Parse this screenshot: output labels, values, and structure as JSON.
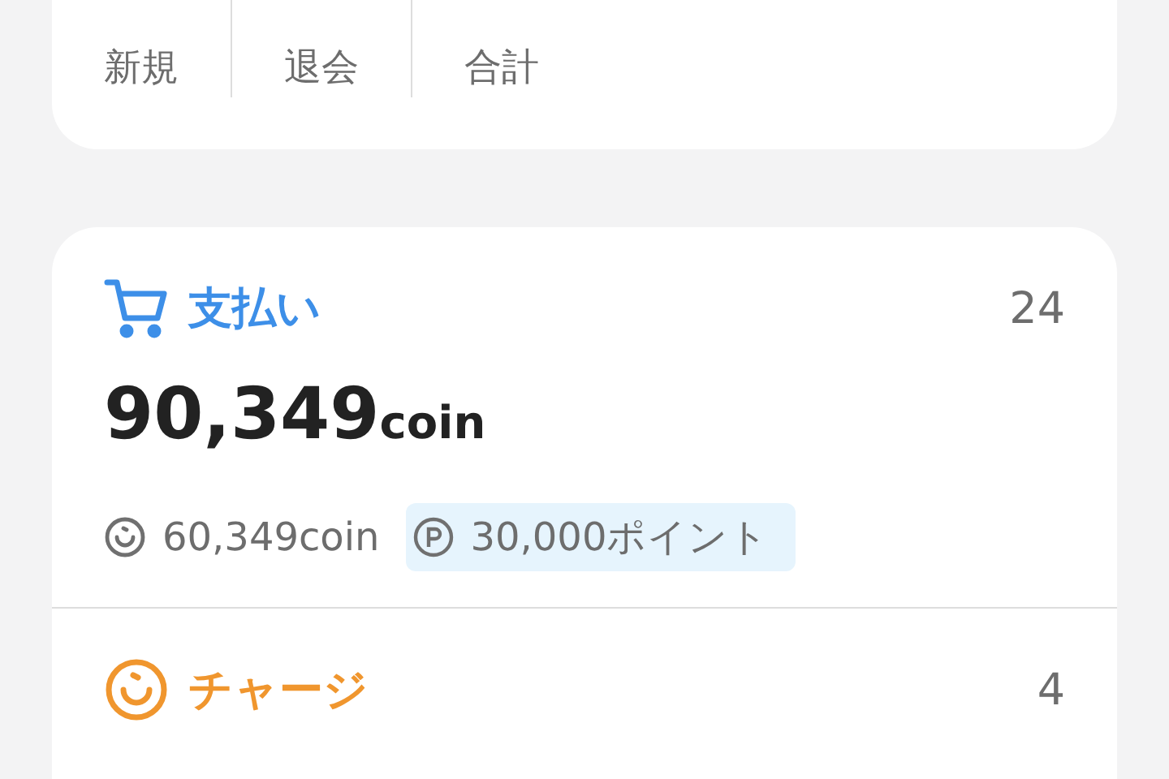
{
  "summary": {
    "labels": [
      "新規",
      "退会",
      "合計"
    ]
  },
  "sections": [
    {
      "kind": "payment",
      "title": "支払い",
      "color": "#3d8fe8",
      "count": "24",
      "amount": "90,349",
      "unit": "coin",
      "breakdown": [
        {
          "kind": "coin",
          "text": "60,349coin",
          "highlighted": false
        },
        {
          "kind": "point",
          "text": "30,000ポイント",
          "highlighted": true
        }
      ]
    },
    {
      "kind": "charge",
      "title": "チャージ",
      "color": "#f0962e",
      "count": "4"
    }
  ]
}
